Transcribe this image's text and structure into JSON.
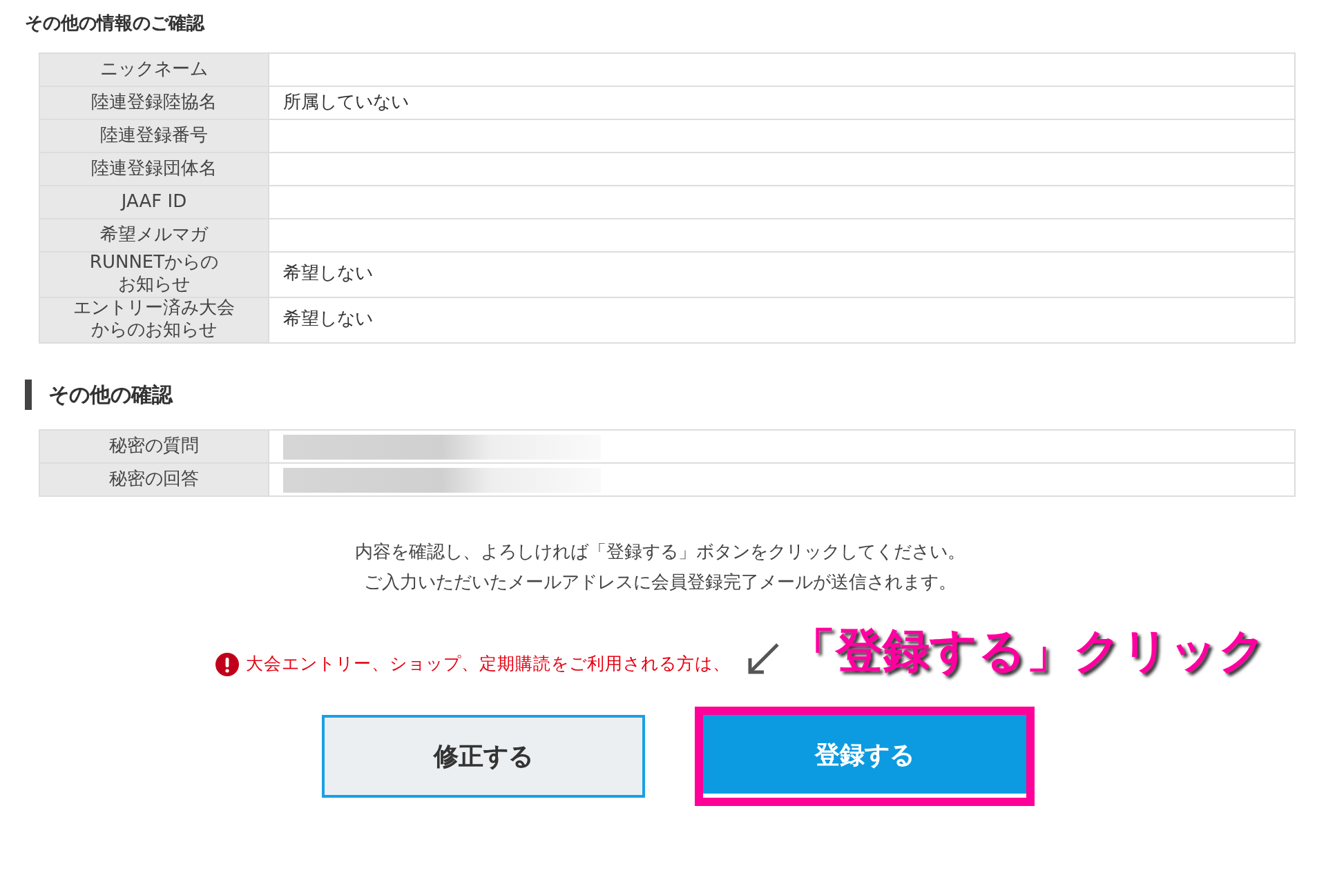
{
  "section1": {
    "title": "その他の情報のご確認",
    "rows": [
      {
        "label": "ニックネーム"
      },
      {
        "label": "陸連登録陸協名",
        "value": "所属していない"
      },
      {
        "label": "陸連登録番号"
      },
      {
        "label": "陸連登録団体名"
      },
      {
        "label": "JAAF ID"
      },
      {
        "label": "希望メルマガ"
      },
      {
        "label": "RUNNETからの",
        "label_line2": "お知らせ",
        "value": "希望しない"
      },
      {
        "label": "エントリー済み大会",
        "label_line2": "からのお知らせ",
        "value": "希望しない"
      }
    ]
  },
  "section2": {
    "title": "その他の確認",
    "rows": [
      {
        "label": "秘密の質問",
        "blurred": true
      },
      {
        "label": "秘密の回答",
        "blurred": true
      }
    ]
  },
  "messages": [
    "内容を確認し、よろしければ「登録する」ボタンをクリックしてください。",
    "ご入力いただいたメールアドレスに会員登録完了メールが送信されます。"
  ],
  "notice": "大会エントリー、ショップ、定期購読をご利用される方は、",
  "annotation": "「登録する」クリック",
  "buttons": [
    {
      "label": "修正する",
      "kind": "secondary"
    },
    {
      "label": "登録する",
      "kind": "primary",
      "highlighted": true
    }
  ]
}
